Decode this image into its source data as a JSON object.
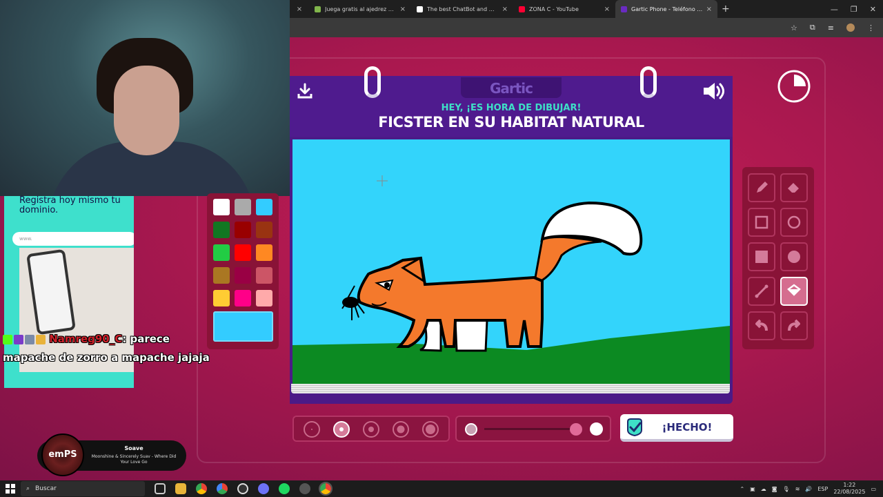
{
  "browser": {
    "tabs": [
      {
        "label": "Juega gratis al ajedrez online c",
        "icon_color": "#81b64c"
      },
      {
        "label": "The best ChatBot and Widgets",
        "icon_color": "#ffffff"
      },
      {
        "label": "ZONA C - YouTube",
        "icon_color": "#ff0033"
      },
      {
        "label": "Gartic Phone - Teléfono Descon",
        "icon_color": "#6a2bc1",
        "active": true
      }
    ],
    "new_tab": "+",
    "close": "×"
  },
  "ad": {
    "text": "Registra hoy mismo tu dominio.",
    "input_placeholder": "www."
  },
  "chat": {
    "user": "Namreg90_C",
    "message_a": ": parece",
    "message_b": "mapache de zorro a mapache jajaja"
  },
  "music": {
    "logo": "emPS",
    "title": "Soave",
    "subtitle": "Moonshine & Sincerely Suav - Where Did Your Love Go"
  },
  "palette": {
    "colors": [
      "#ffffff",
      "#aaaaaa",
      "#33ccff",
      "#117722",
      "#990000",
      "#993311",
      "#22cc44",
      "#ff0000",
      "#ff8822",
      "#aa7722",
      "#990044",
      "#cc5566",
      "#ffcc33",
      "#ff0088",
      "#ffaaaa"
    ],
    "selected": "#33ccff"
  },
  "gartic": {
    "logo": "Gartic",
    "subtitle": "HEY, ¡ES HORA DE DIBUJAR!",
    "title": "FICSTER EN SU HABITAT NATURAL",
    "done_label": "¡HECHO!",
    "accent": "#3ee0c7",
    "header_color": "#4f1b8e"
  },
  "tools": [
    "pencil-icon",
    "eraser-icon",
    "rect-outline-icon",
    "ellipse-outline-icon",
    "rect-fill-icon",
    "ellipse-fill-icon",
    "line-icon",
    "bucket-icon",
    "undo-icon",
    "redo-icon"
  ],
  "brush_sizes": {
    "count": 5,
    "selected_index": 1
  },
  "opacity": {
    "level": 1.0
  },
  "timer": {
    "remaining_fraction": 0.75
  },
  "taskbar": {
    "search": "Buscar",
    "lang": "ESP",
    "time": "1:22",
    "date": "22/08/2025"
  }
}
